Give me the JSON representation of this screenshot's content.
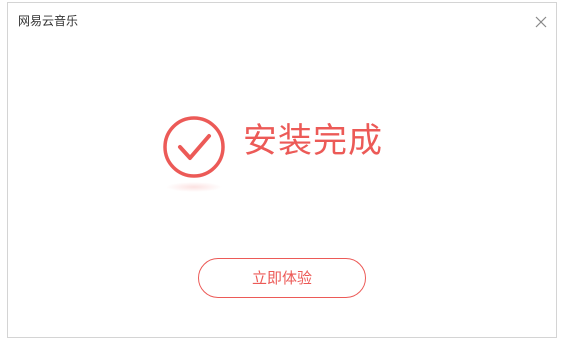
{
  "window": {
    "title": "网易云音乐"
  },
  "status": {
    "message": "安装完成"
  },
  "actions": {
    "start_label": "立即体验"
  },
  "icons": {
    "close": "close-icon",
    "success": "check-circle-icon"
  },
  "colors": {
    "accent": "#ec5a57",
    "border": "#d4d4d4",
    "title_text": "#333333"
  }
}
